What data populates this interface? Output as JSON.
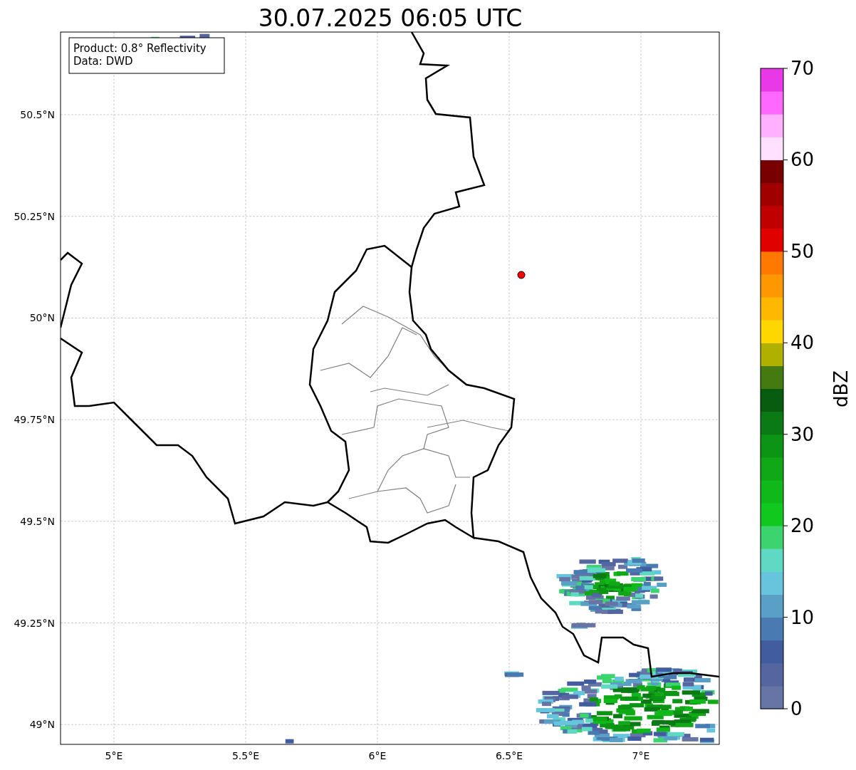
{
  "title": "30.07.2025 06:05 UTC",
  "legend": [
    "Product: 0.8° Reflectivity",
    "Data: DWD"
  ],
  "x_ticks": [
    "5°E",
    "5.5°E",
    "6°E",
    "6.5°E",
    "7°E"
  ],
  "y_ticks": [
    "50.5°N",
    "50.25°N",
    "50°N",
    "49.75°N",
    "49.5°N",
    "49.25°N",
    "49°N"
  ],
  "colorbar": {
    "label": "dBZ",
    "ticks": [
      "70",
      "60",
      "50",
      "40",
      "30",
      "20",
      "10",
      "0"
    ],
    "segments": [
      {
        "color": "#6674a6"
      },
      {
        "color": "#5565a0"
      },
      {
        "color": "#425ca0"
      },
      {
        "color": "#4a7ab2"
      },
      {
        "color": "#5a9fc6"
      },
      {
        "color": "#66c4dc"
      },
      {
        "color": "#5fd8c4"
      },
      {
        "color": "#3cd46e"
      },
      {
        "color": "#10c81e"
      },
      {
        "color": "#10b81a"
      },
      {
        "color": "#10a816"
      },
      {
        "color": "#0c9414"
      },
      {
        "color": "#0a7a14"
      },
      {
        "color": "#085c10"
      },
      {
        "color": "#447a10"
      },
      {
        "color": "#b0b000"
      },
      {
        "color": "#ffd700"
      },
      {
        "color": "#ffb800"
      },
      {
        "color": "#ff9800"
      },
      {
        "color": "#ff7800"
      },
      {
        "color": "#e00000"
      },
      {
        "color": "#c00000"
      },
      {
        "color": "#a00000"
      },
      {
        "color": "#780000"
      },
      {
        "color": "#ffe0ff"
      },
      {
        "color": "#ffb0ff"
      },
      {
        "color": "#ff68ff"
      },
      {
        "color": "#e838e8"
      }
    ]
  }
}
